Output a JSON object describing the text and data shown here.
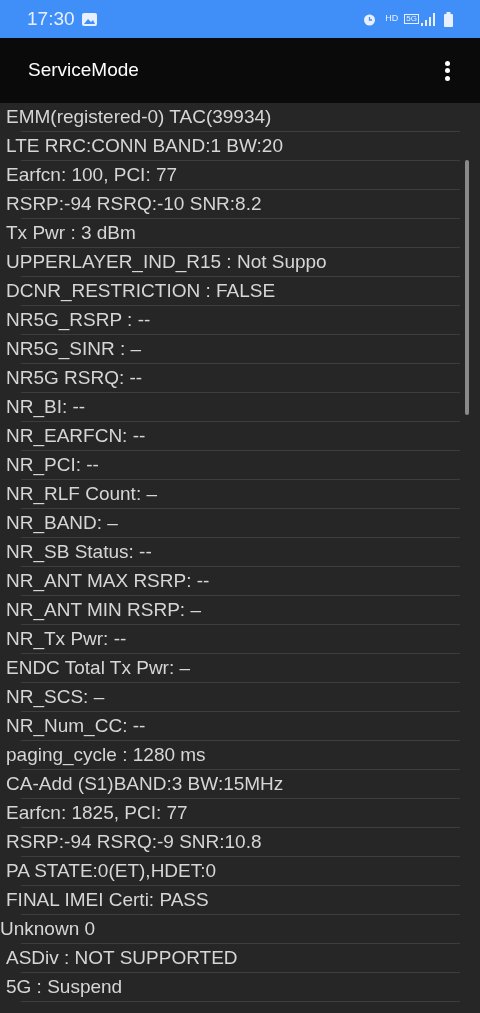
{
  "status_bar": {
    "time": "17:30",
    "hd": "HD",
    "network": "5G"
  },
  "app_bar": {
    "title": "ServiceMode"
  },
  "rows": [
    {
      "text": "EMM(registered-0) TAC(39934)",
      "kind": "normal"
    },
    {
      "text": "LTE RRC:CONN BAND:1 BW:20",
      "kind": "normal"
    },
    {
      "text": "Earfcn: 100, PCI: 77",
      "kind": "normal"
    },
    {
      "text": "RSRP:-94 RSRQ:-10 SNR:8.2",
      "kind": "normal"
    },
    {
      "text": "Tx Pwr : 3 dBm",
      "kind": "normal"
    },
    {
      "text": "UPPERLAYER_IND_R15 : Not Suppo",
      "kind": "normal"
    },
    {
      "text": "DCNR_RESTRICTION : FALSE",
      "kind": "normal"
    },
    {
      "text": "NR5G_RSRP : --",
      "kind": "normal"
    },
    {
      "text": "NR5G_SINR : –",
      "kind": "normal"
    },
    {
      "text": "NR5G RSRQ: --",
      "kind": "normal"
    },
    {
      "text": "NR_BI: --",
      "kind": "normal"
    },
    {
      "text": "NR_EARFCN: --",
      "kind": "normal"
    },
    {
      "text": "NR_PCI: --",
      "kind": "normal"
    },
    {
      "text": "NR_RLF Count: –",
      "kind": "normal"
    },
    {
      "text": "NR_BAND: –",
      "kind": "normal"
    },
    {
      "text": "NR_SB Status: --",
      "kind": "normal"
    },
    {
      "text": "NR_ANT MAX RSRP: --",
      "kind": "normal"
    },
    {
      "text": "NR_ANT MIN RSRP: –",
      "kind": "normal"
    },
    {
      "text": "NR_Tx Pwr: --",
      "kind": "normal"
    },
    {
      "text": "ENDC Total Tx Pwr: –",
      "kind": "normal"
    },
    {
      "text": "NR_SCS: –",
      "kind": "normal"
    },
    {
      "text": "NR_Num_CC: --",
      "kind": "normal"
    },
    {
      "text": "paging_cycle : 1280 ms",
      "kind": "normal"
    },
    {
      "text": "CA-Add (S1)BAND:3 BW:15MHz",
      "kind": "normal"
    },
    {
      "text": "Earfcn: 1825, PCI: 77",
      "kind": "normal"
    },
    {
      "text": "RSRP:-94 RSRQ:-9 SNR:10.8",
      "kind": "normal"
    },
    {
      "text": "PA STATE:0(ET),HDET:0",
      "kind": "normal"
    },
    {
      "text": "FINAL IMEI Certi: PASS",
      "kind": "normal"
    },
    {
      "text": "Unknown 0",
      "kind": "flush"
    },
    {
      "text": "ASDiv : NOT SUPPORTED",
      "kind": "normal"
    },
    {
      "text": "5G : Suspend",
      "kind": "normal"
    }
  ]
}
